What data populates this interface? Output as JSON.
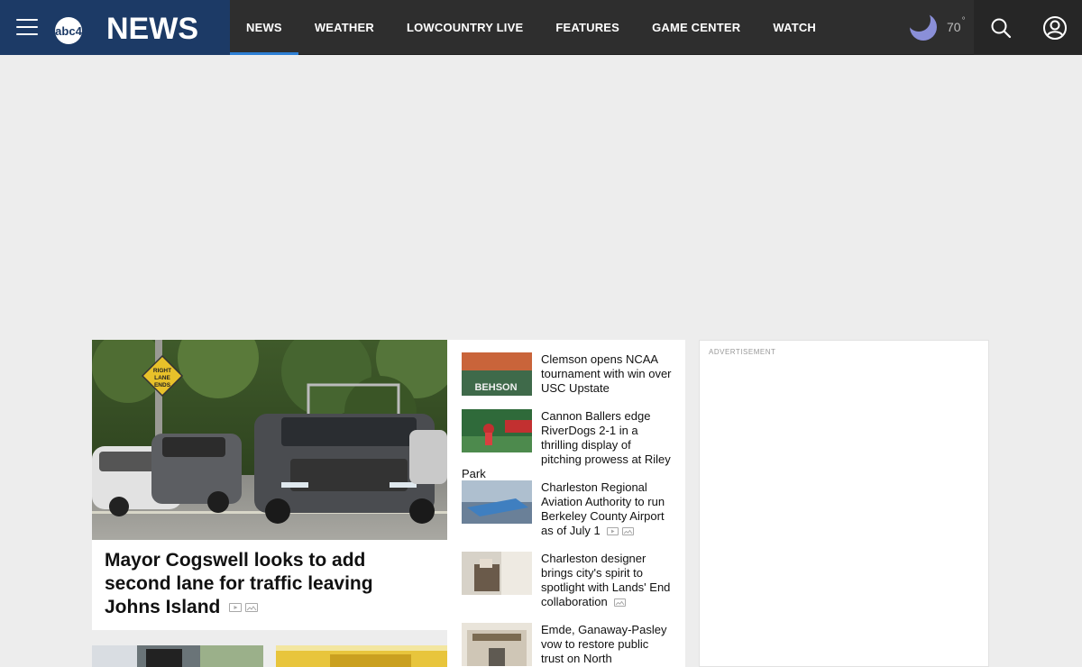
{
  "header": {
    "logo_text": "NEWS",
    "logo_badge": "abc4",
    "nav": [
      {
        "label": "NEWS",
        "active": true
      },
      {
        "label": "WEATHER",
        "active": false
      },
      {
        "label": "LOWCOUNTRY LIVE",
        "active": false
      },
      {
        "label": "FEATURES",
        "active": false
      },
      {
        "label": "GAME CENTER",
        "active": false
      },
      {
        "label": "WATCH",
        "active": false
      }
    ],
    "weather": {
      "temp": "70",
      "degree": "°",
      "icon": "moon-icon"
    },
    "colors": {
      "brand_bg": "#1c3a66",
      "header_bg": "#2e2e2e",
      "active_underline": "#2d7fd4"
    }
  },
  "lead": {
    "headline": "Mayor Cogswell looks to add second lane for traffic leaving Johns Island",
    "sign_text": [
      "RIGHT",
      "LANE",
      "ENDS"
    ],
    "media": [
      "video-icon",
      "gallery-icon"
    ]
  },
  "stories": [
    {
      "title": "Clemson opens NCAA tournament with win over USC Upstate",
      "media": []
    },
    {
      "title": "Cannon Ballers edge RiverDogs 2-1 in a thrilling display of pitching prowess at Riley Park",
      "media": []
    },
    {
      "title": "Charleston Regional Aviation Authority to run Berkeley County Airport as of July 1",
      "media": [
        "video-icon",
        "gallery-icon"
      ]
    },
    {
      "title": "Charleston designer brings city's spirit to spotlight with Lands' End collaboration",
      "media": [
        "gallery-icon"
      ]
    },
    {
      "title": "Emde, Ganaway-Pasley vow to restore public trust on North",
      "media": []
    }
  ],
  "ad": {
    "label": "ADVERTISEMENT"
  }
}
